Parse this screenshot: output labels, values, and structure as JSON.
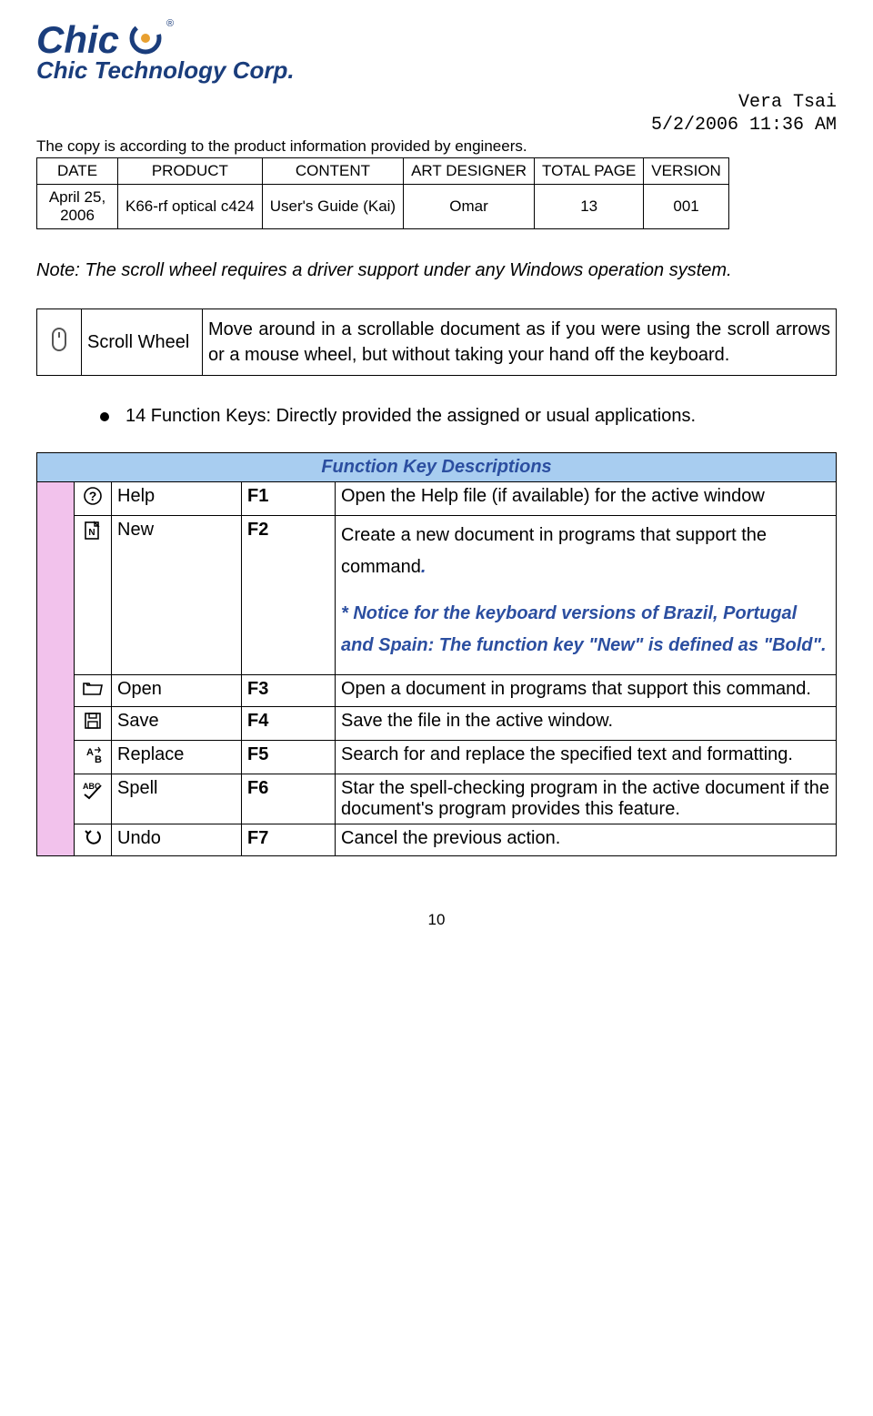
{
  "logo": {
    "main": "Chic",
    "reg": "®",
    "sub": "Chic Technology Corp."
  },
  "meta": {
    "author": "Vera Tsai",
    "timestamp": "5/2/2006 11:36 AM"
  },
  "copy_note": "The copy is according to the product information provided by engineers.",
  "info_table": {
    "headers": [
      "DATE",
      "PRODUCT",
      "CONTENT",
      "ART DESIGNER",
      "TOTAL PAGE",
      "VERSION"
    ],
    "row": [
      "April 25, 2006",
      "K66-rf optical c424",
      "User's Guide (Kai)",
      "Omar",
      "13",
      "001"
    ]
  },
  "note": "Note: The scroll wheel requires a driver support under any Windows operation system.",
  "scroll": {
    "label": "Scroll Wheel",
    "desc": "Move around in a scrollable document as if you were using the scroll arrows or a mouse wheel, but without taking your hand off the keyboard."
  },
  "bullet": "14 Function Keys: Directly provided the assigned or usual applications.",
  "func_header": "Function Key Descriptions",
  "rows": [
    {
      "name": "Help",
      "key": "F1",
      "desc": "Open the Help file (if available) for the active window"
    },
    {
      "name": "New",
      "key": "F2",
      "desc": "Create a new document in programs that support the command",
      "dot": ".",
      "extra": "* Notice for the keyboard versions of Brazil, Portugal and Spain: The function key \"New\" is defined as \"Bold\"."
    },
    {
      "name": "Open",
      "key": "F3",
      "desc": "Open a document in programs that support this command."
    },
    {
      "name": "Save",
      "key": "F4",
      "desc": "Save the file in the active window."
    },
    {
      "name": "Replace",
      "key": "F5",
      "desc": "Search for and replace the specified text and formatting."
    },
    {
      "name": "Spell",
      "key": "F6",
      "desc": "Star the spell-checking program in the active document if the document's program provides this feature."
    },
    {
      "name": "Undo",
      "key": "F7",
      "desc": "Cancel the previous action."
    }
  ],
  "page_number": "10"
}
